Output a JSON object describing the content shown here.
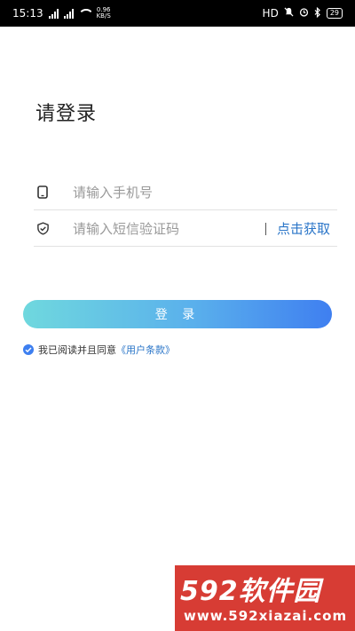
{
  "status_bar": {
    "time": "15:13",
    "net_speed": "0.96",
    "net_unit": "KB/S",
    "hd_label": "HD",
    "battery": "29"
  },
  "page": {
    "title": "请登录"
  },
  "form": {
    "phone_placeholder": "请输入手机号",
    "code_placeholder": "请输入短信验证码",
    "get_code_label": "点击获取",
    "login_label": "登 录"
  },
  "agreement": {
    "text": "我已阅读并且同意",
    "terms_label": "《用户条款》",
    "checked": true
  },
  "watermark": {
    "brand": "592软件园",
    "url": "www.592xiazai.com"
  },
  "colors": {
    "accent": "#2a75c8",
    "button_start": "#6fd8de",
    "button_end": "#3f7ff0"
  }
}
